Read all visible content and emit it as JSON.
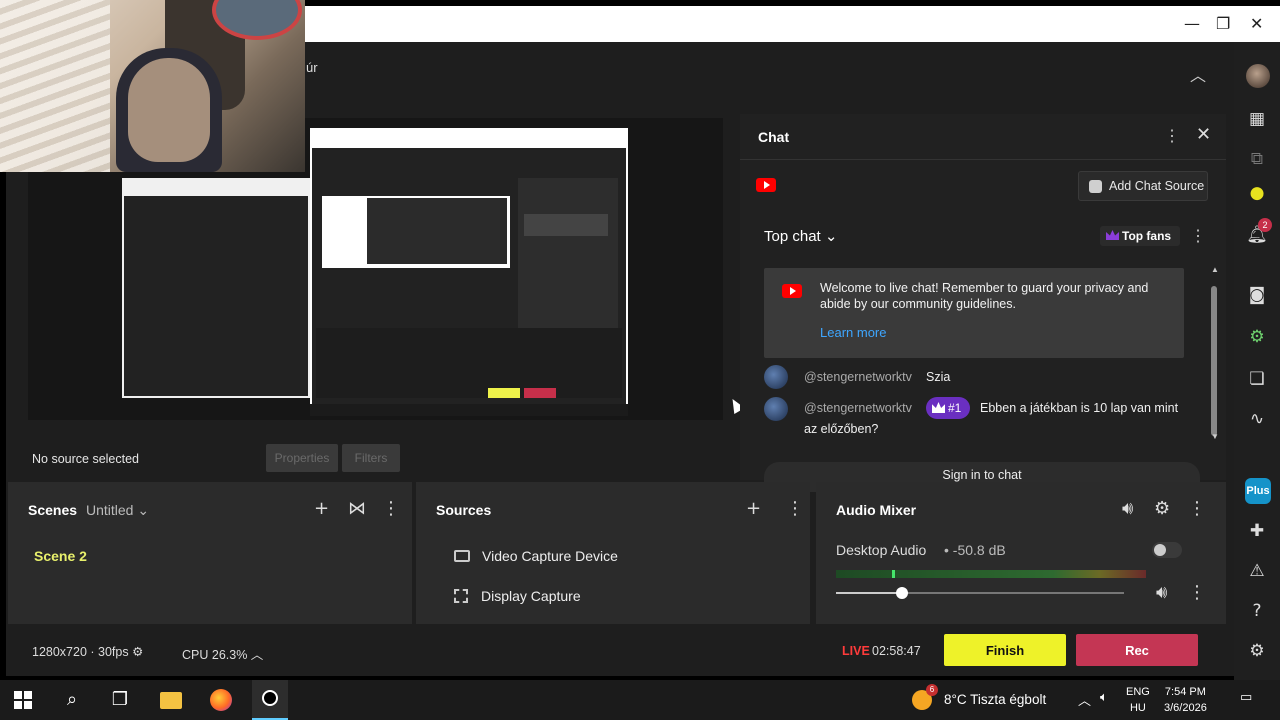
{
  "window": {
    "title_fragment": "úr",
    "minimize": "—",
    "restore": "❐",
    "close": "✕"
  },
  "chat": {
    "title": "Chat",
    "add_chat_source": "Add Chat Source",
    "top_chat": "Top chat",
    "top_fans": "Top fans",
    "welcome_text": "Welcome to live chat! Remember to guard your privacy and abide by our community guidelines.",
    "learn_more": "Learn more",
    "messages": [
      {
        "user": "@stengernetworktv",
        "text": "Szia",
        "badge": ""
      },
      {
        "user": "@stengernetworktv",
        "text": "Ebben a játékban is 10 lap van mint",
        "text2": "az előzőben?",
        "badge": "#1"
      }
    ],
    "sign_in": "Sign in to chat"
  },
  "source_bar": {
    "no_source": "No source selected",
    "properties": "Properties",
    "filters": "Filters"
  },
  "scenes": {
    "title": "Scenes",
    "collection": "Untitled",
    "items": [
      "Scene 2"
    ]
  },
  "sources": {
    "title": "Sources",
    "items": [
      "Video Capture Device",
      "Display Capture"
    ]
  },
  "audio_mixer": {
    "title": "Audio Mixer",
    "channel": "Desktop Audio",
    "level": "-50.8 dB",
    "volume_fraction": 0.23,
    "meter_fraction": 0.18
  },
  "status": {
    "resolution": "1280x720 · 30fps",
    "cpu": "CPU 26.3%",
    "live_label": "LIVE",
    "elapsed": "02:58:47",
    "finish": "Finish",
    "rec": "Rec"
  },
  "sidebar": {
    "plus": "Plus",
    "notifications": "2"
  },
  "taskbar": {
    "weather_badge": "6",
    "weather": "8°C  Tiszta égbolt",
    "lang_1": "ENG",
    "lang_2": "HU",
    "time": "7:54 PM",
    "date": "3/6/2026"
  }
}
